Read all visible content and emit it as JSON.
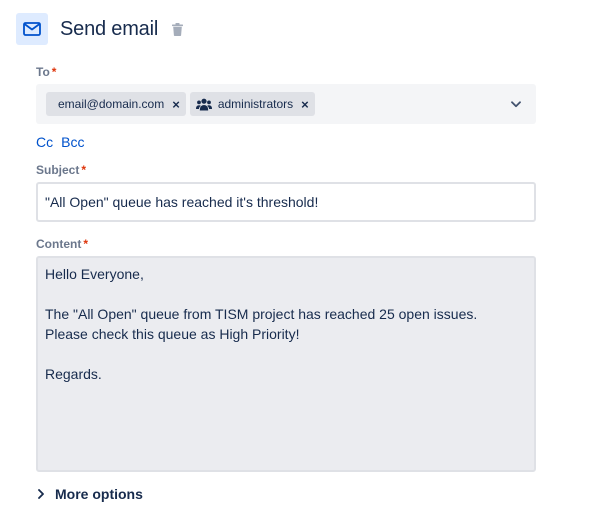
{
  "header": {
    "title": "Send email",
    "icon": "mail-icon",
    "delete_icon": "trash-icon"
  },
  "to": {
    "label": "To",
    "required_mark": "*",
    "recipients": [
      {
        "label": "email@domain.com",
        "icon": null,
        "remove": "×"
      },
      {
        "label": "administrators",
        "icon": "group-icon",
        "remove": "×"
      }
    ],
    "dropdown_icon": "chevron-down-icon"
  },
  "cc_label": "Cc",
  "bcc_label": "Bcc",
  "subject": {
    "label": "Subject",
    "required_mark": "*",
    "value": "\"All Open\" queue has reached it's threshold!"
  },
  "content": {
    "label": "Content",
    "required_mark": "*",
    "value": "Hello Everyone,\n\nThe \"All Open\" queue from TISM project has reached 25 open issues.\nPlease check this queue as High Priority!\n\nRegards."
  },
  "more_options": {
    "label": "More options",
    "icon": "chevron-right-icon"
  },
  "colors": {
    "accent": "#0052CC",
    "required": "#DE350B",
    "text": "#172B4D",
    "label": "#6B778C",
    "icon_bg": "#DEEBFF"
  }
}
